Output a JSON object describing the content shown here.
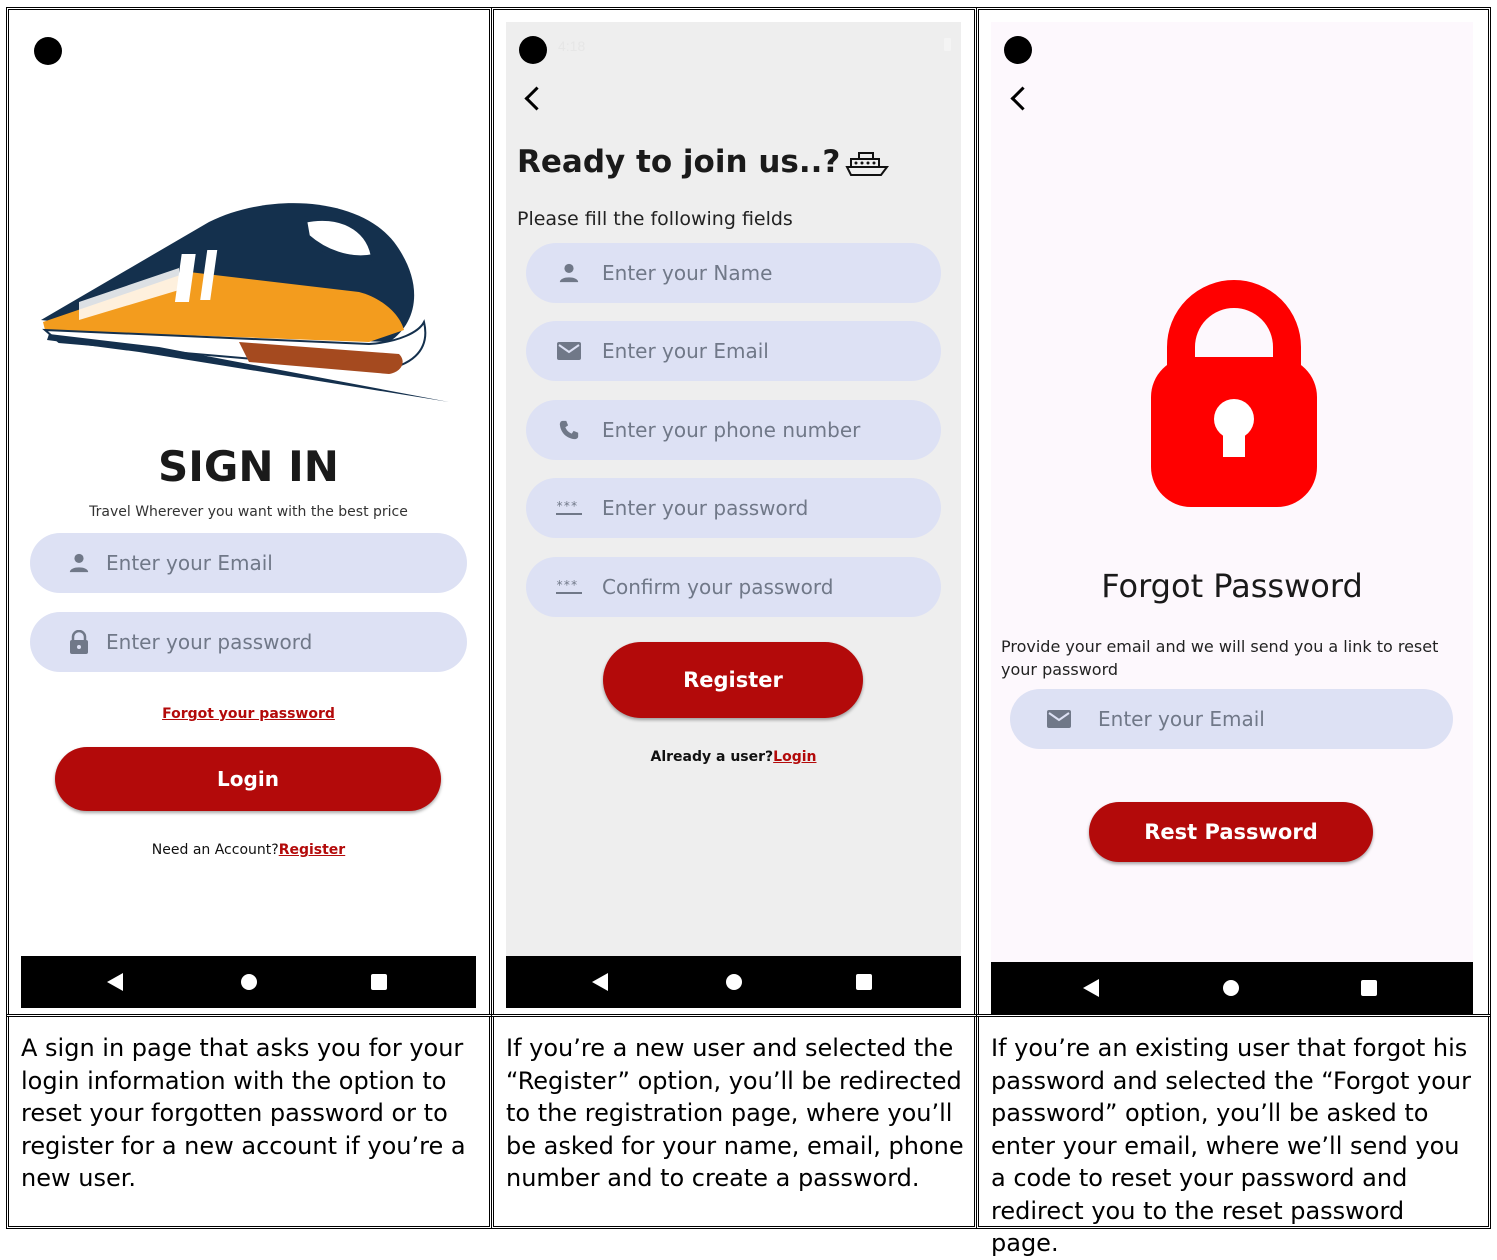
{
  "signin": {
    "title": "SIGN IN",
    "subtitle": "Travel Wherever you want with the best price",
    "email_placeholder": "Enter your Email",
    "password_placeholder": "Enter your password",
    "forgot_link": "Forgot your password",
    "login_button": "Login",
    "need_account": "Need an Account?",
    "register_link": "Register",
    "caption": "A sign in page that asks you for your login information with the option to reset your forgotten password or to register for a new account if you’re a new user."
  },
  "register": {
    "status_time": "4:18",
    "title": "Ready to join us..?",
    "subtitle": "Please fill the following fields",
    "fields": [
      {
        "icon": "person-icon",
        "placeholder": "Enter your Name"
      },
      {
        "icon": "mail-icon",
        "placeholder": "Enter your Email"
      },
      {
        "icon": "phone-icon",
        "placeholder": "Enter your phone number"
      },
      {
        "icon": "password-icon",
        "placeholder": "Enter your password"
      },
      {
        "icon": "password-icon",
        "placeholder": "Confirm your password"
      }
    ],
    "register_button": "Register",
    "already_user": "Already a user?",
    "login_link": "Login",
    "caption": "If you’re a new user and selected the “Register” option, you’ll be redirected to the registration page, where you’ll be asked for your name, email, phone number and to create a password."
  },
  "forgot": {
    "title": "Forgot Password",
    "description": "Provide your email and we will send you a link to reset your password",
    "email_placeholder": "Enter your Email",
    "reset_button": "Rest Password",
    "caption": "If you’re an existing user that forgot his password and selected the “Forgot your password” option, you’ll be asked to enter your email, where we’ll send you a code to reset your password and redirect you to the reset password page."
  },
  "colors": {
    "accent": "#b30a0a",
    "field_bg": "#dde1f4",
    "register_bg": "#eeeeee",
    "lock_red": "#ff0000",
    "train_navy": "#14304d",
    "train_orange": "#f39c1e"
  }
}
